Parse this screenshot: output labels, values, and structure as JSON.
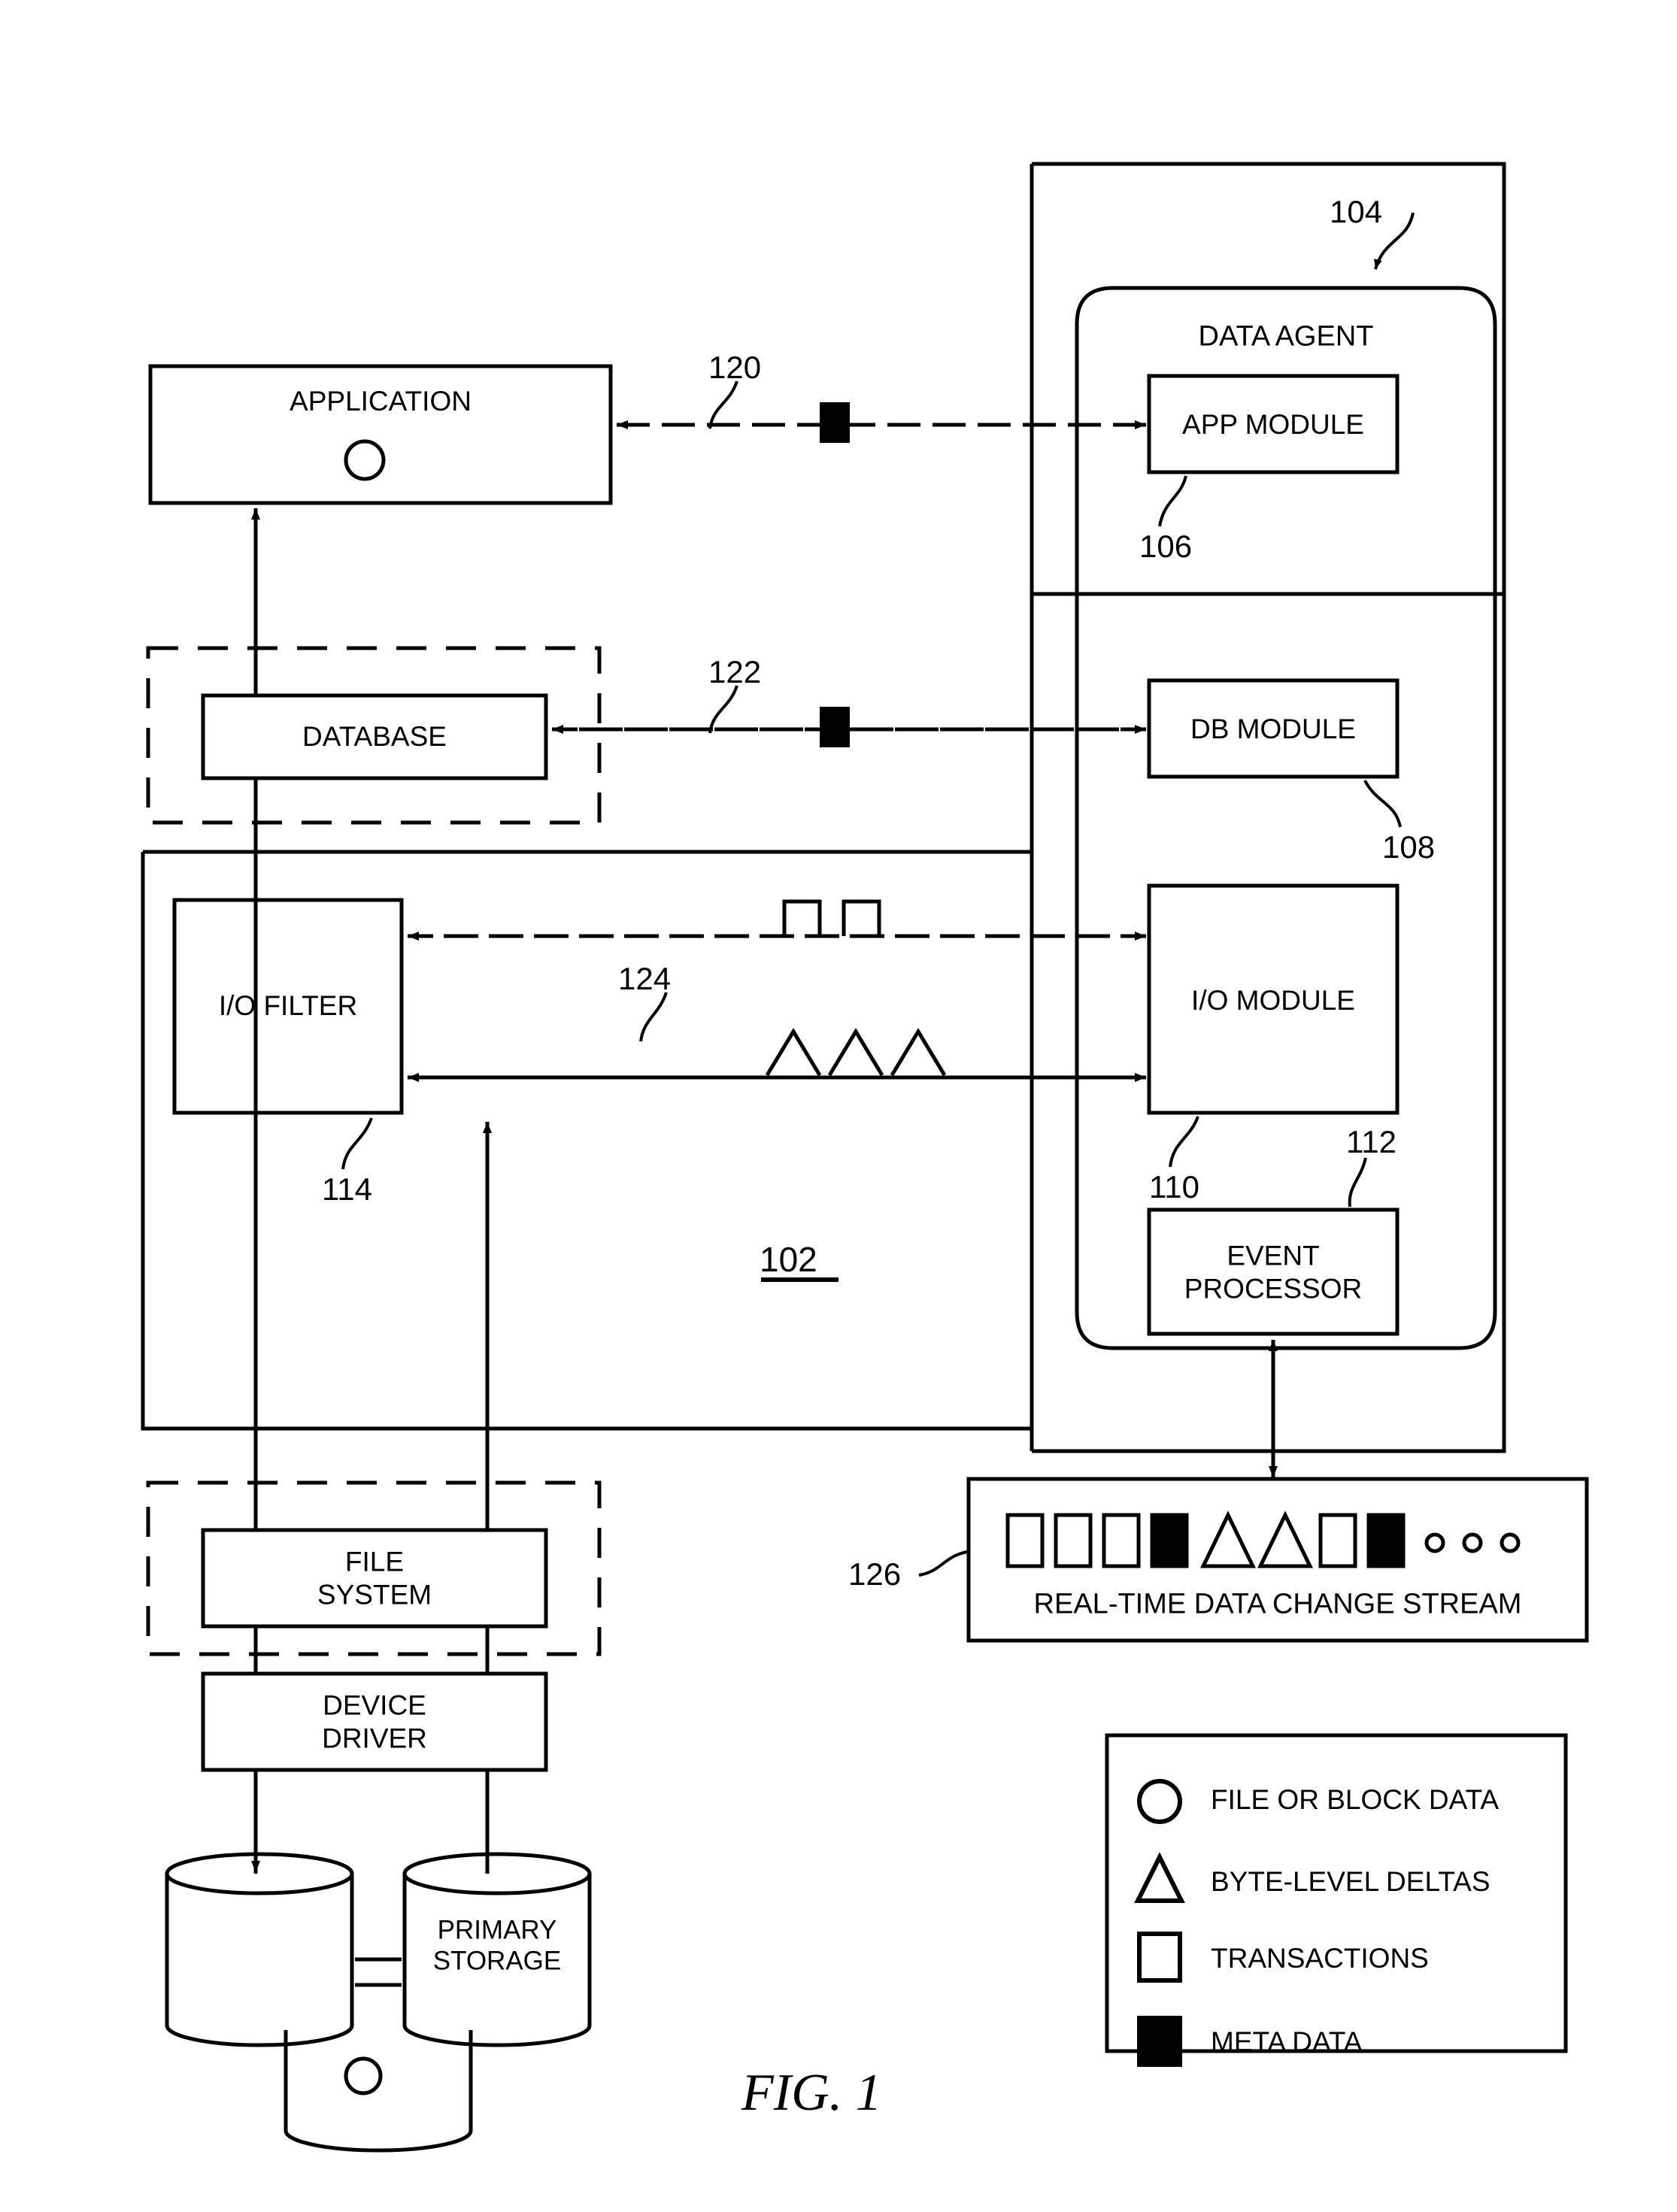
{
  "figure": {
    "caption": "FIG. 1",
    "system_ref": "102"
  },
  "blocks": {
    "application": {
      "label": "APPLICATION",
      "glyph": "circle"
    },
    "database": {
      "label": "DATABASE"
    },
    "io_filter": {
      "label": "I/O FILTER",
      "ref": "114"
    },
    "file_system": {
      "label": "FILE\nSYSTEM"
    },
    "device_driver": {
      "label": "DEVICE\nDRIVER"
    },
    "primary_storage": {
      "label": "PRIMARY\nSTORAGE",
      "glyph": "circle"
    },
    "data_agent": {
      "label": "DATA AGENT",
      "ref": "104"
    },
    "app_module": {
      "label": "APP MODULE",
      "ref": "106"
    },
    "db_module": {
      "label": "DB MODULE",
      "ref": "108"
    },
    "io_module": {
      "label": "I/O MODULE",
      "ref": "110"
    },
    "event_processor": {
      "label": "EVENT\nPROCESSOR",
      "ref": "112"
    },
    "stream": {
      "label": "REAL-TIME DATA CHANGE STREAM",
      "ref": "126"
    }
  },
  "connections": {
    "app_link_ref": "120",
    "db_link_ref": "122",
    "io_link_ref": "124"
  },
  "stream_sequence": [
    "open-square",
    "open-square",
    "open-square",
    "filled-square",
    "triangle",
    "triangle",
    "open-square",
    "filled-square",
    "dot",
    "dot",
    "dot"
  ],
  "legend": {
    "items": [
      {
        "glyph": "circle",
        "label": "FILE OR BLOCK DATA"
      },
      {
        "glyph": "triangle",
        "label": "BYTE-LEVEL DELTAS"
      },
      {
        "glyph": "open-square",
        "label": "TRANSACTIONS"
      },
      {
        "glyph": "filled-square",
        "label": "META DATA"
      }
    ]
  },
  "colors": {
    "ink": "#000000",
    "paper": "#ffffff"
  }
}
